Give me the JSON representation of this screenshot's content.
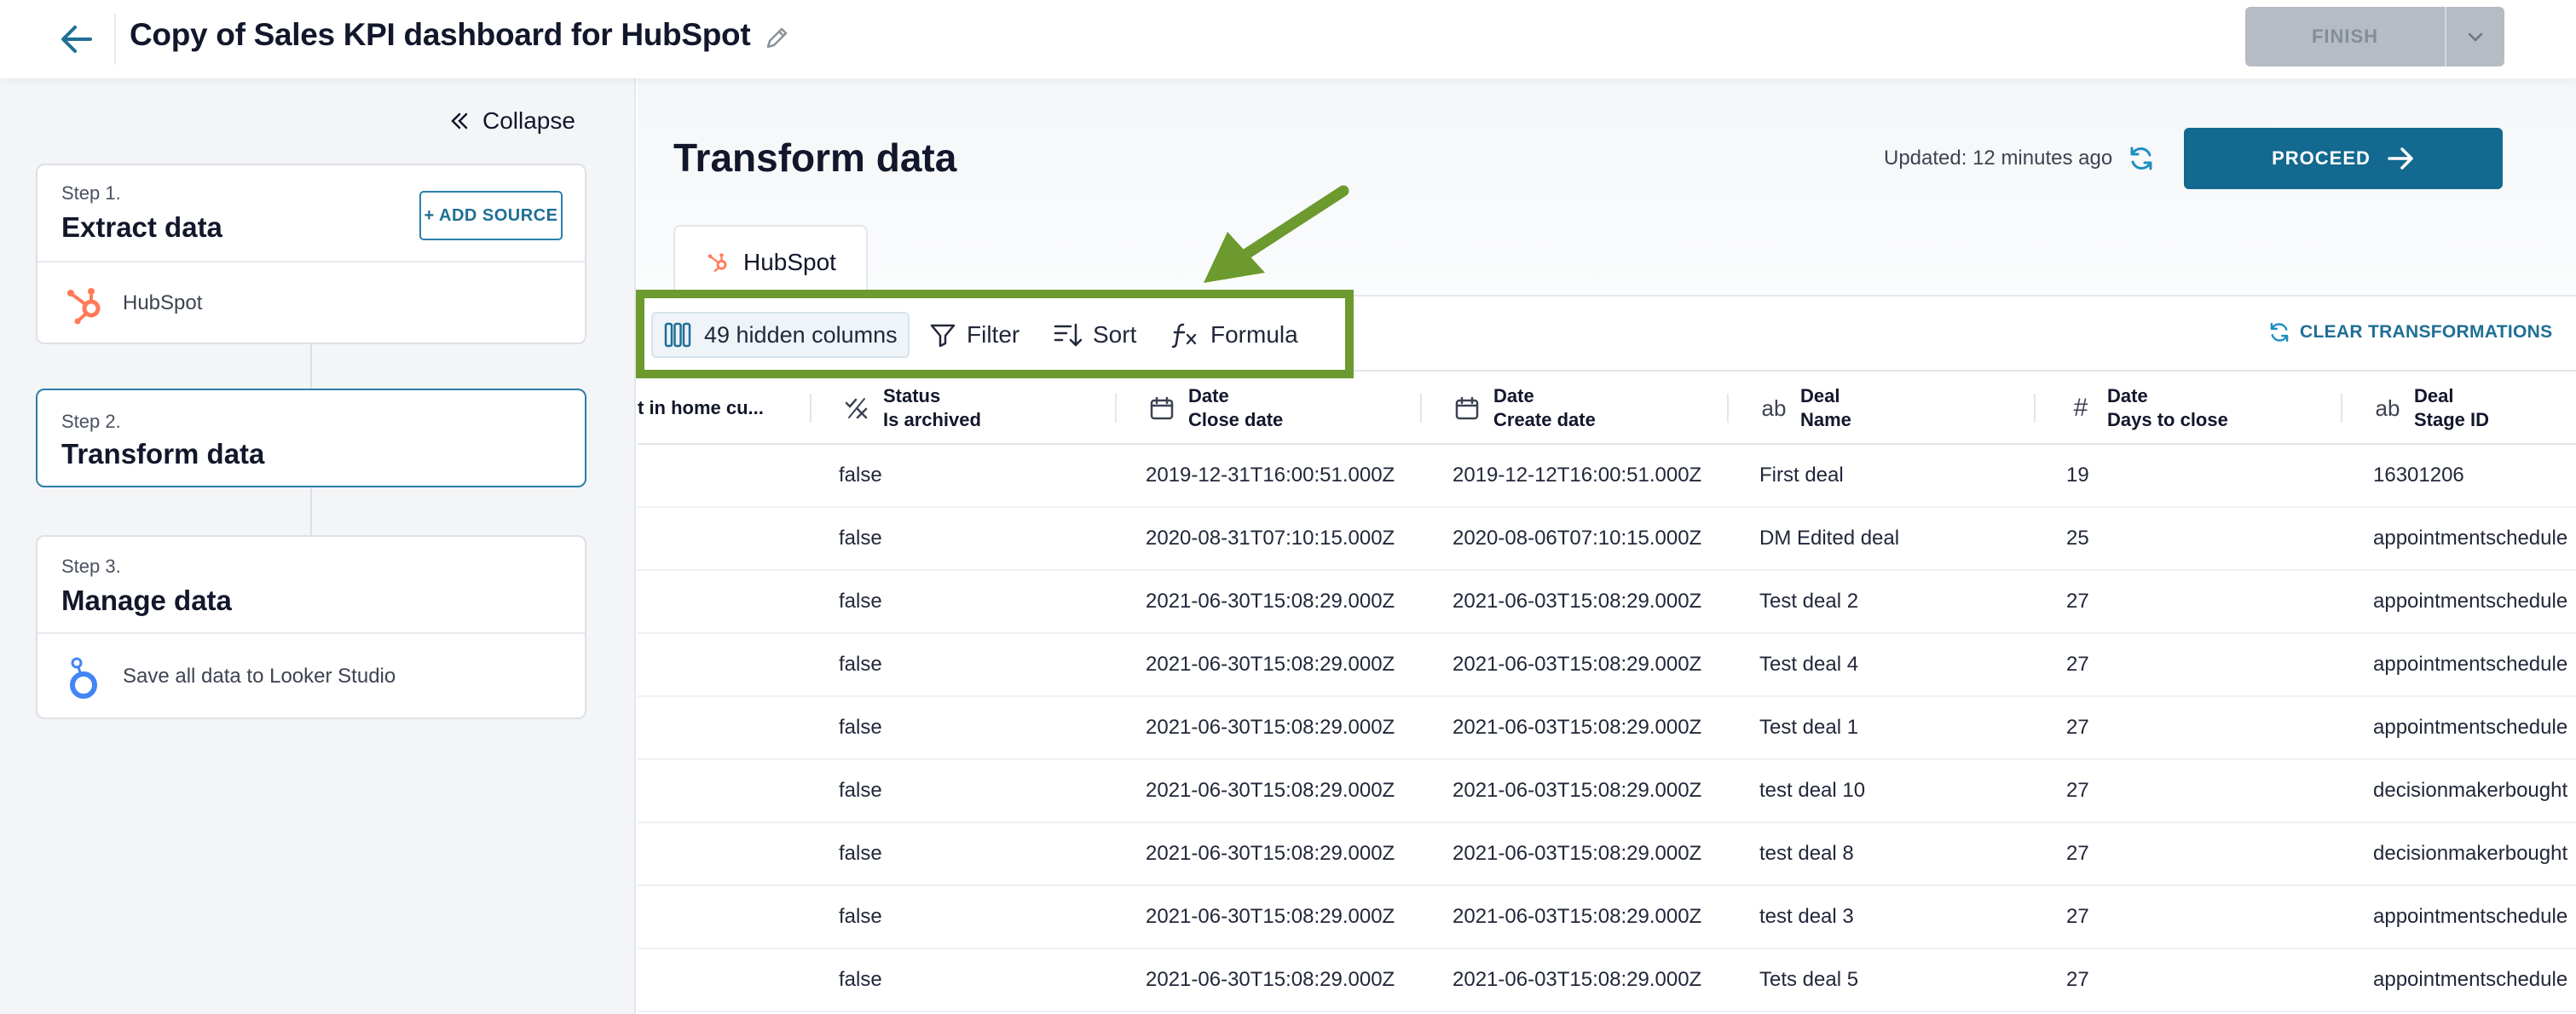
{
  "header": {
    "title": "Copy of Sales KPI dashboard for HubSpot",
    "finish_label": "FINISH"
  },
  "sidebar": {
    "collapse_label": "Collapse",
    "steps": [
      {
        "label": "Step 1.",
        "title": "Extract data",
        "action": "+ ADD SOURCE",
        "sub": "HubSpot"
      },
      {
        "label": "Step 2.",
        "title": "Transform data"
      },
      {
        "label": "Step 3.",
        "title": "Manage data",
        "sub": "Save all data to Looker Studio"
      }
    ]
  },
  "main": {
    "title": "Transform data",
    "updated": "Updated: 12 minutes ago",
    "proceed_label": "PROCEED",
    "source_tab": "HubSpot",
    "toolbar": {
      "hidden_columns": "49 hidden columns",
      "filter": "Filter",
      "sort": "Sort",
      "formula": "Formula",
      "clear": "CLEAR TRANSFORMATIONS"
    }
  },
  "table": {
    "columns": [
      {
        "l1": "",
        "l2": "t in home cu...",
        "icon": ""
      },
      {
        "l1": "Status",
        "l2": "Is archived",
        "icon": "boolean-icon"
      },
      {
        "l1": "Date",
        "l2": "Close date",
        "icon": "calendar-icon"
      },
      {
        "l1": "Date",
        "l2": "Create date",
        "icon": "calendar-icon"
      },
      {
        "l1": "Deal",
        "l2": "Name",
        "icon": "text-icon"
      },
      {
        "l1": "Date",
        "l2": "Days to close",
        "icon": "number-icon"
      },
      {
        "l1": "Deal",
        "l2": "Stage ID",
        "icon": "text-icon"
      }
    ],
    "rows": [
      [
        "",
        "false",
        "2019-12-31T16:00:51.000Z",
        "2019-12-12T16:00:51.000Z",
        "First deal",
        "19",
        "16301206"
      ],
      [
        "",
        "false",
        "2020-08-31T07:10:15.000Z",
        "2020-08-06T07:10:15.000Z",
        "DM Edited deal",
        "25",
        "appointmentschedule"
      ],
      [
        "",
        "false",
        "2021-06-30T15:08:29.000Z",
        "2021-06-03T15:08:29.000Z",
        "Test deal 2",
        "27",
        "appointmentschedule"
      ],
      [
        "",
        "false",
        "2021-06-30T15:08:29.000Z",
        "2021-06-03T15:08:29.000Z",
        "Test deal 4",
        "27",
        "appointmentschedule"
      ],
      [
        "",
        "false",
        "2021-06-30T15:08:29.000Z",
        "2021-06-03T15:08:29.000Z",
        "Test deal 1",
        "27",
        "appointmentschedule"
      ],
      [
        "",
        "false",
        "2021-06-30T15:08:29.000Z",
        "2021-06-03T15:08:29.000Z",
        "test deal 10",
        "27",
        "decisionmakerbought"
      ],
      [
        "",
        "false",
        "2021-06-30T15:08:29.000Z",
        "2021-06-03T15:08:29.000Z",
        "test deal 8",
        "27",
        "decisionmakerbought"
      ],
      [
        "",
        "false",
        "2021-06-30T15:08:29.000Z",
        "2021-06-03T15:08:29.000Z",
        "test deal 3",
        "27",
        "appointmentschedule"
      ],
      [
        "",
        "false",
        "2021-06-30T15:08:29.000Z",
        "2021-06-03T15:08:29.000Z",
        "Tets deal 5",
        "27",
        "appointmentschedule"
      ]
    ]
  },
  "colors": {
    "accent": "#13698f",
    "highlight": "#6c9a2e",
    "hubspot": "#ff7a59"
  }
}
